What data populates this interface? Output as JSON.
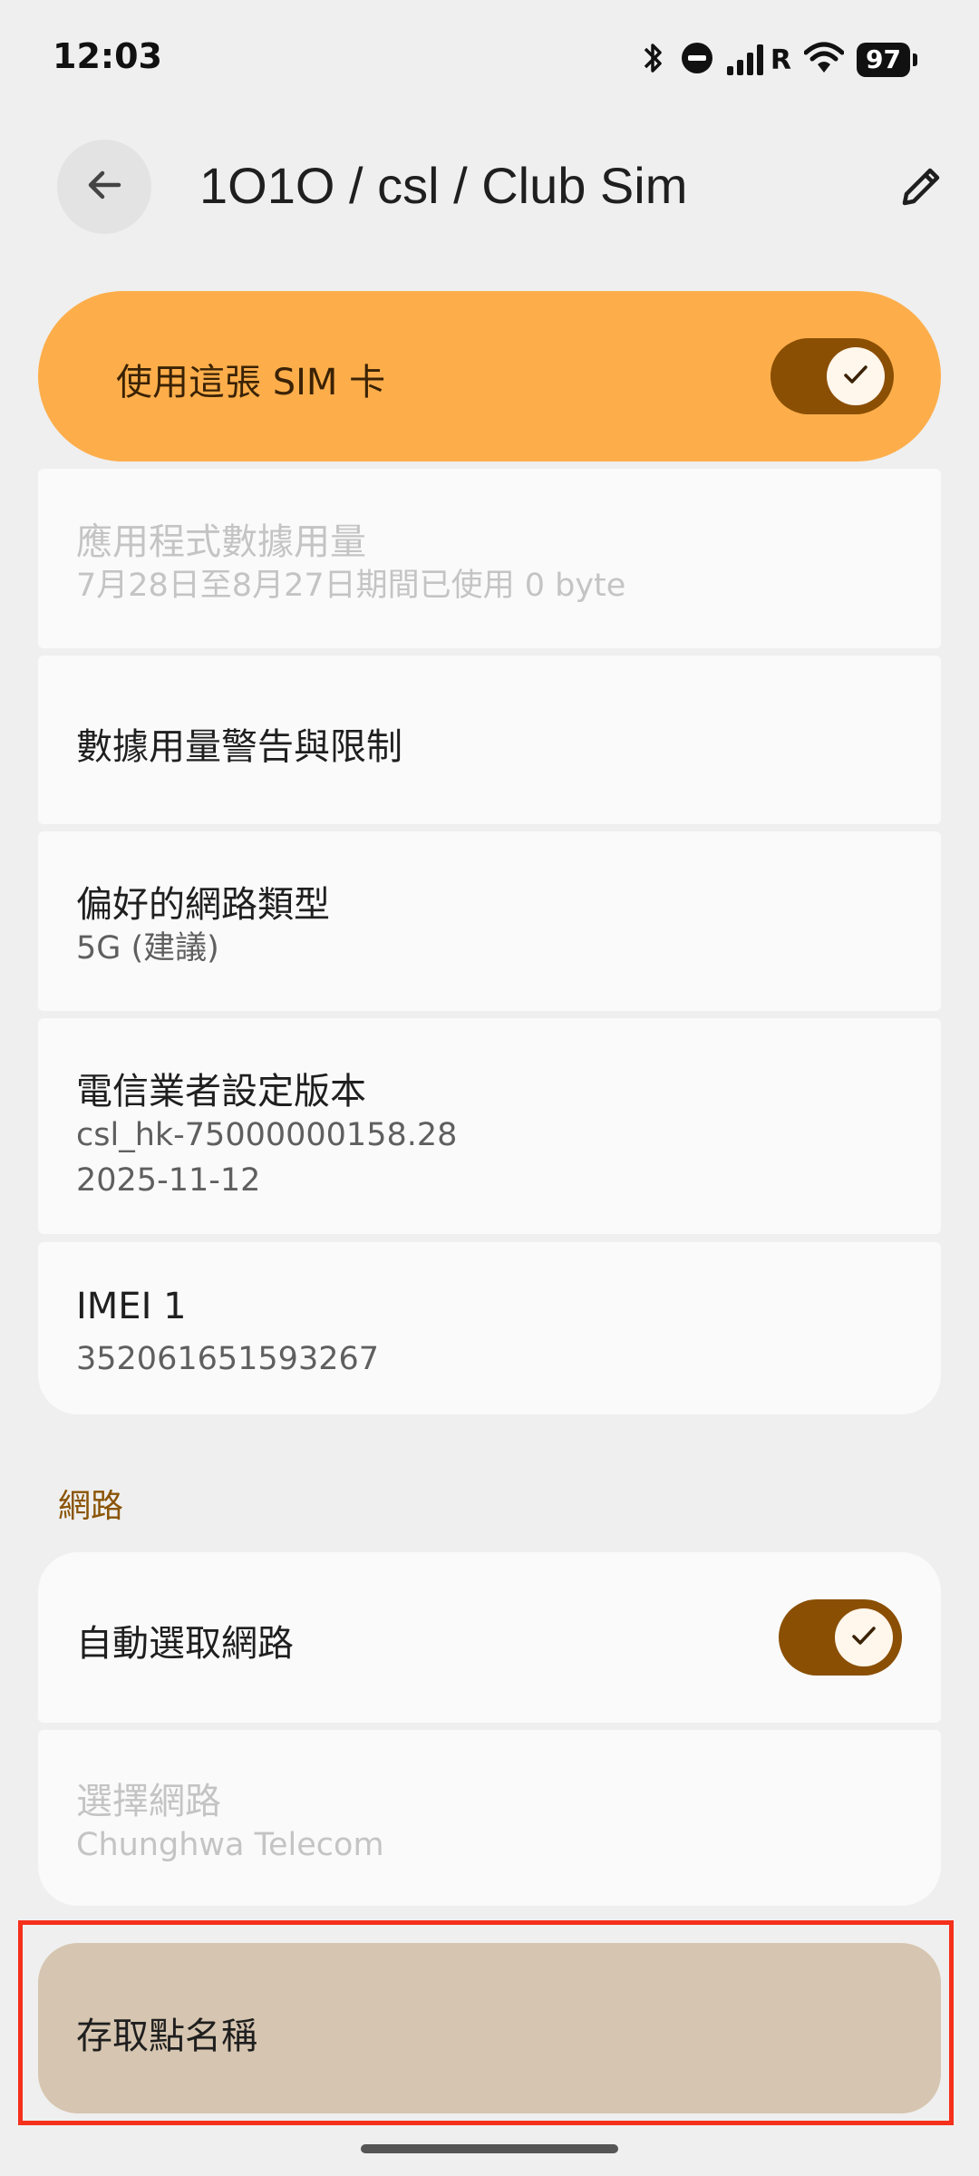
{
  "status_bar": {
    "time": "12:03",
    "roaming": "R",
    "battery": "97",
    "icons": [
      "bluetooth-icon",
      "do-not-disturb-icon",
      "signal-icon",
      "wifi-icon",
      "battery-icon"
    ]
  },
  "app_bar": {
    "title": "1O1O / csl / Club Sim",
    "icons": [
      "back-arrow-icon",
      "pencil-icon"
    ]
  },
  "use_sim": {
    "label": "使用這張 SIM 卡",
    "enabled": true
  },
  "settings": [
    {
      "title": "應用程式數據用量",
      "subtitle": "7月28日至8月27日期間已使用 0 byte",
      "disabled": true
    },
    {
      "title": "數據用量警告與限制"
    },
    {
      "title": "偏好的網路類型",
      "subtitle": "5G (建議)"
    },
    {
      "title": "電信業者設定版本",
      "subtitle": "csl_hk-75000000158.28",
      "subtitle2": "2025-11-12"
    },
    {
      "title": "IMEI 1",
      "subtitle": "352061651593267"
    }
  ],
  "network": {
    "section_title": "網路",
    "auto_select": {
      "label": "自動選取網路",
      "enabled": true
    },
    "select": {
      "title": "選擇網路",
      "subtitle": "Chunghwa Telecom",
      "disabled": true
    }
  },
  "apn": {
    "label": "存取點名稱"
  },
  "colors": {
    "accent": "#fdae4b",
    "switch_track": "#8a4f03",
    "section": "#8a5406",
    "highlight_border": "#f5301b",
    "apn_bg": "#d6c5b0"
  }
}
